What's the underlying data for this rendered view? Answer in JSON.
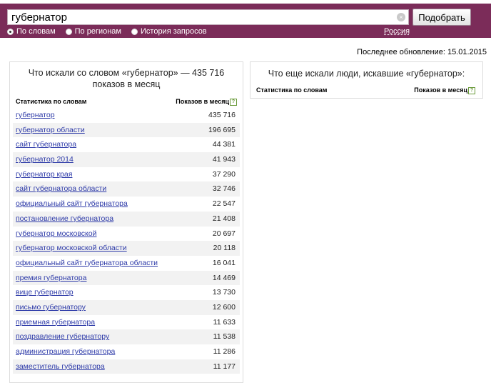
{
  "search": {
    "query": "губернатор",
    "submit_label": "Подобрать",
    "clear_icon": "×"
  },
  "modes": [
    {
      "label": "По словам",
      "selected": true
    },
    {
      "label": "По регионам",
      "selected": false
    },
    {
      "label": "История запросов",
      "selected": false
    }
  ],
  "region": "Россия",
  "updated": "Последнее обновление: 15.01.2015",
  "left_panel": {
    "title_line1": "Что искали со словом «губернатор» — 435 716",
    "title_line2": "показов в месяц",
    "col_phrase": "Статистика по словам",
    "col_count": "Показов в месяц",
    "help": "?",
    "rows": [
      {
        "phrase": "губернатор",
        "count": "435 716"
      },
      {
        "phrase": "губернатор области",
        "count": "196 695"
      },
      {
        "phrase": "сайт губернатора",
        "count": "44 381"
      },
      {
        "phrase": "губернатор 2014",
        "count": "41 943"
      },
      {
        "phrase": "губернатор края",
        "count": "37 290"
      },
      {
        "phrase": "сайт губернатора области",
        "count": "32 746"
      },
      {
        "phrase": "официальный сайт губернатора",
        "count": "22 547"
      },
      {
        "phrase": "постановление губернатора",
        "count": "21 408"
      },
      {
        "phrase": "губернатор московской",
        "count": "20 697"
      },
      {
        "phrase": "губернатор московской области",
        "count": "20 118"
      },
      {
        "phrase": "официальный сайт губернатора области",
        "count": "16 041"
      },
      {
        "phrase": "премия губернатора",
        "count": "14 469"
      },
      {
        "phrase": "вице губернатор",
        "count": "13 730"
      },
      {
        "phrase": "письмо губернатору",
        "count": "12 600"
      },
      {
        "phrase": "приемная губернатора",
        "count": "11 633"
      },
      {
        "phrase": "поздравление губернатору",
        "count": "11 538"
      },
      {
        "phrase": "администрация губернатора",
        "count": "11 286"
      },
      {
        "phrase": "заместитель губернатора",
        "count": "11 177"
      }
    ]
  },
  "right_panel": {
    "title": "Что еще искали люди, искавшие «губернатор»:",
    "col_phrase": "Статистика по словам",
    "col_count": "Показов в месяц",
    "help": "?"
  }
}
